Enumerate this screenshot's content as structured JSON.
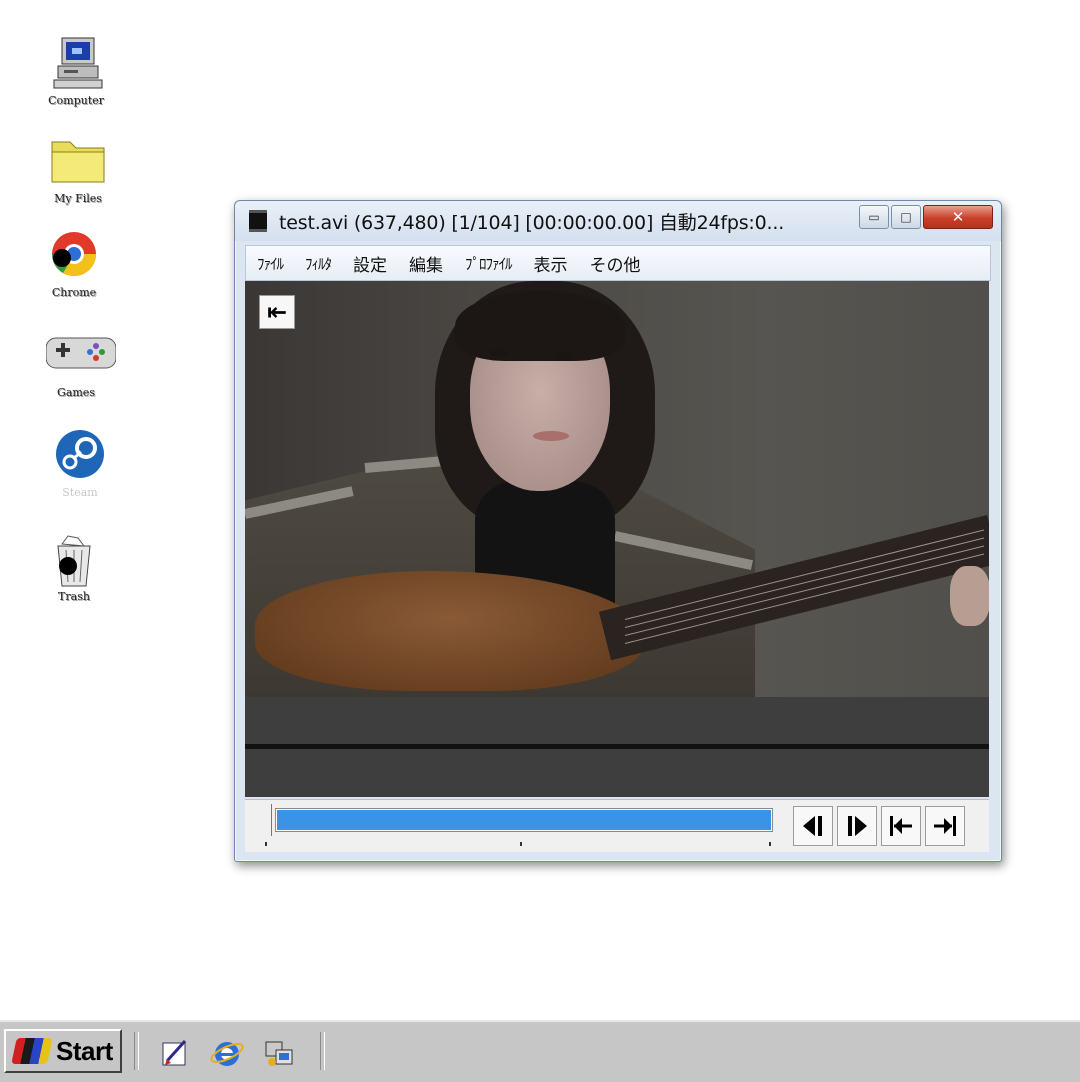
{
  "desktop": {
    "icons": [
      {
        "label": "Computer"
      },
      {
        "label": "My Files"
      },
      {
        "label": "Chrome"
      },
      {
        "label": "Games"
      },
      {
        "label": "Steam"
      },
      {
        "label": "Trash"
      }
    ]
  },
  "window": {
    "title": "test.avi (637,480)  [1/104] [00:00:00.00]  自動24fps:0...",
    "buttons": {
      "minimize": "▭",
      "maximize": "□",
      "close": "✕"
    },
    "menu": [
      "ﾌｧｲﾙ",
      "ﾌｨﾙﾀ",
      "設定",
      "編集",
      "ﾌﾟﾛﾌｧｲﾙ",
      "表示",
      "その他"
    ],
    "overlay_icon": "seek-to-start-icon",
    "seek_fraction": 0.0,
    "playback_fill_fraction": 1.0,
    "nav_buttons": [
      "prev-frame-icon",
      "next-frame-icon",
      "first-frame-icon",
      "last-frame-icon"
    ]
  },
  "taskbar": {
    "start_label": "Start",
    "quick_launch": [
      "edit-document-icon",
      "internet-explorer-icon",
      "network-share-icon"
    ]
  },
  "colors": {
    "progress_fill": "#3b93e6",
    "close_button": "#c9402a",
    "taskbar": "#c6c6c6"
  }
}
